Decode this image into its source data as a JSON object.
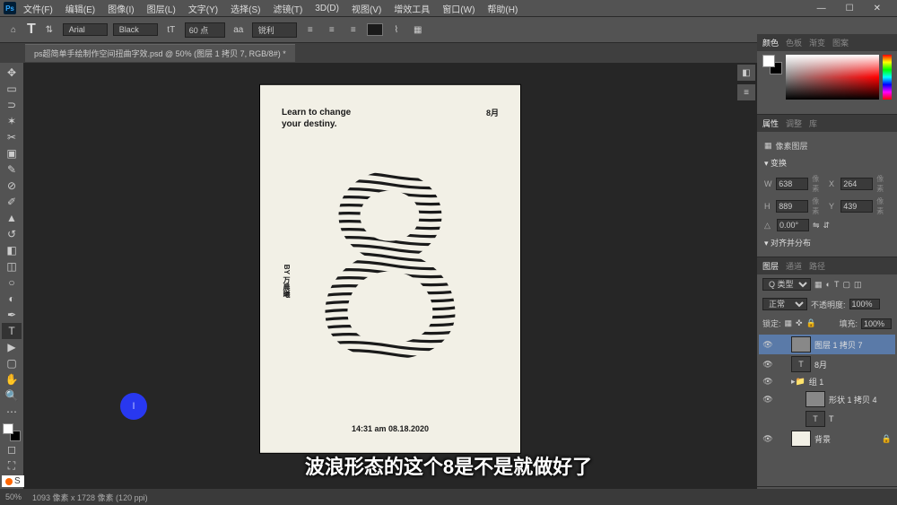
{
  "menu": {
    "items": [
      "文件(F)",
      "编辑(E)",
      "图像(I)",
      "图层(L)",
      "文字(Y)",
      "选择(S)",
      "滤镜(T)",
      "3D(D)",
      "视图(V)",
      "增效工具",
      "窗口(W)",
      "帮助(H)"
    ]
  },
  "options": {
    "font": "Arial",
    "weight": "Black",
    "size": "60 点",
    "aa": "锐利"
  },
  "tab": {
    "title": "ps超简单手绘制作空间扭曲字效.psd @ 50% (图层 1 拷贝 7, RGB/8#) *"
  },
  "artboard": {
    "headline_l1": "Learn to change",
    "headline_l2": "your destiny.",
    "month": "8月",
    "by_label": "BY",
    "by_name": "万晨曦",
    "footer": "14:31 am 08.18.2020"
  },
  "subtitle": "波浪形态的这个8是不是就做好了",
  "panels": {
    "color_tabs": [
      "颜色",
      "色板",
      "渐变",
      "图案"
    ],
    "prop_tabs": [
      "属性",
      "调整",
      "库"
    ],
    "prop_title": "像素图层",
    "transform": "变换",
    "w": "638",
    "w_unit": "像素",
    "x": "264",
    "x_unit": "像素",
    "h": "889",
    "h_unit": "像素",
    "y": "439",
    "y_unit": "像素",
    "angle": "0.00°",
    "align": "对齐并分布",
    "layer_tabs": [
      "图层",
      "通道",
      "路径"
    ],
    "kind": "Q 类型",
    "blend": "正常",
    "opacity_lbl": "不透明度:",
    "opacity": "100%",
    "lock_lbl": "锁定:",
    "fill_lbl": "填充:",
    "fill": "100%",
    "layers": [
      {
        "name": "图层 1 拷贝 7",
        "type": "pixel",
        "sel": true
      },
      {
        "name": "8月",
        "type": "text"
      },
      {
        "name": "组 1",
        "type": "group"
      },
      {
        "name": "形状 1 拷贝 4",
        "type": "shape"
      },
      {
        "name": "T",
        "type": "text"
      },
      {
        "name": "背景",
        "type": "bg"
      }
    ]
  },
  "status": {
    "zoom": "50%",
    "doc": "1093 像素 x 1728 像素 (120 ppi)"
  },
  "badge": "S"
}
